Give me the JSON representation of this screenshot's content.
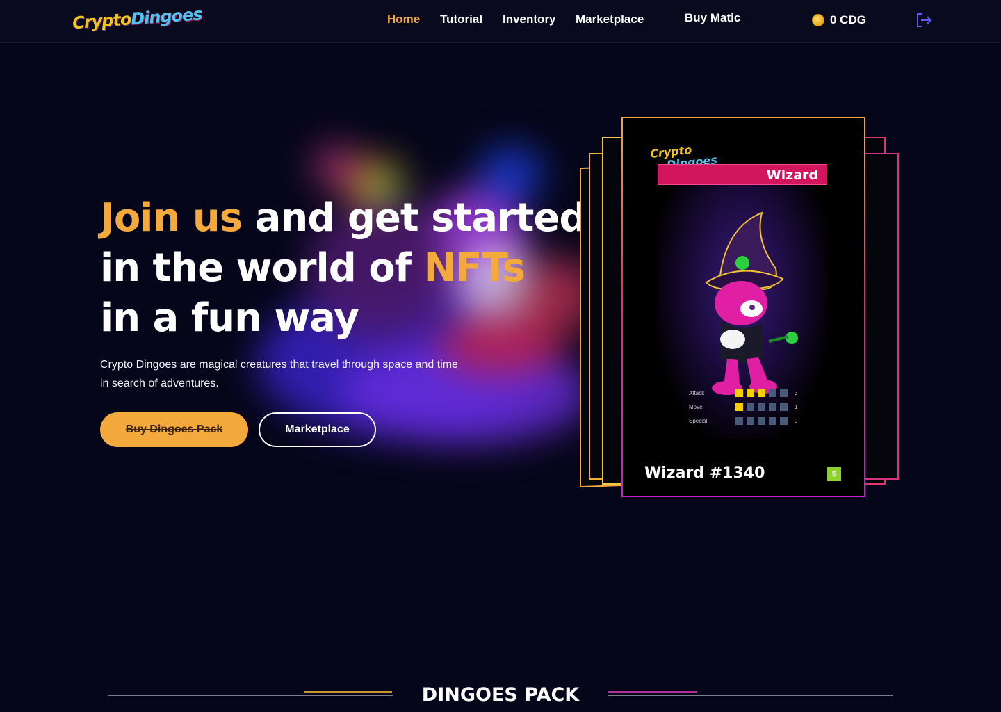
{
  "header": {
    "logo": {
      "line1": "Crypto",
      "line2": "Dingoes"
    },
    "nav": [
      {
        "label": "Home",
        "active": true
      },
      {
        "label": "Tutorial",
        "active": false
      },
      {
        "label": "Inventory",
        "active": false
      },
      {
        "label": "Marketplace",
        "active": false
      },
      {
        "label": "Buy Matic",
        "active": false
      }
    ],
    "balance": "0  CDG",
    "icons": {
      "coin": "coin-icon",
      "logout": "logout-icon"
    }
  },
  "hero": {
    "headline": {
      "part1": "Join us",
      "part2": " and get started",
      "part3": "in the world of ",
      "part4": "NFTs",
      "part5": "in a fun way"
    },
    "description": "Crypto Dingoes are magical creatures that travel through space and time in search of adventures.",
    "buttons": {
      "primary": "Buy Dingoes Pack",
      "secondary": "Marketplace"
    }
  },
  "card": {
    "logo": {
      "line1": "Crypto",
      "line2": "Dingoes"
    },
    "class": "Wizard",
    "name": "Wizard #1340",
    "badge": "$",
    "stats": [
      {
        "label": "Attack",
        "value": "3",
        "level": 3,
        "max": 5
      },
      {
        "label": "Move",
        "value": "1",
        "level": 1,
        "max": 5
      },
      {
        "label": "Special",
        "value": "0",
        "level": 0,
        "max": 5
      }
    ]
  },
  "section": {
    "title": "DINGOES PACK"
  },
  "colors": {
    "accent": "#f4a93c",
    "background": "#06061a",
    "card_band": "#d1165e",
    "stat_on": "#f5d000",
    "stat_off": "#4b5a78"
  }
}
